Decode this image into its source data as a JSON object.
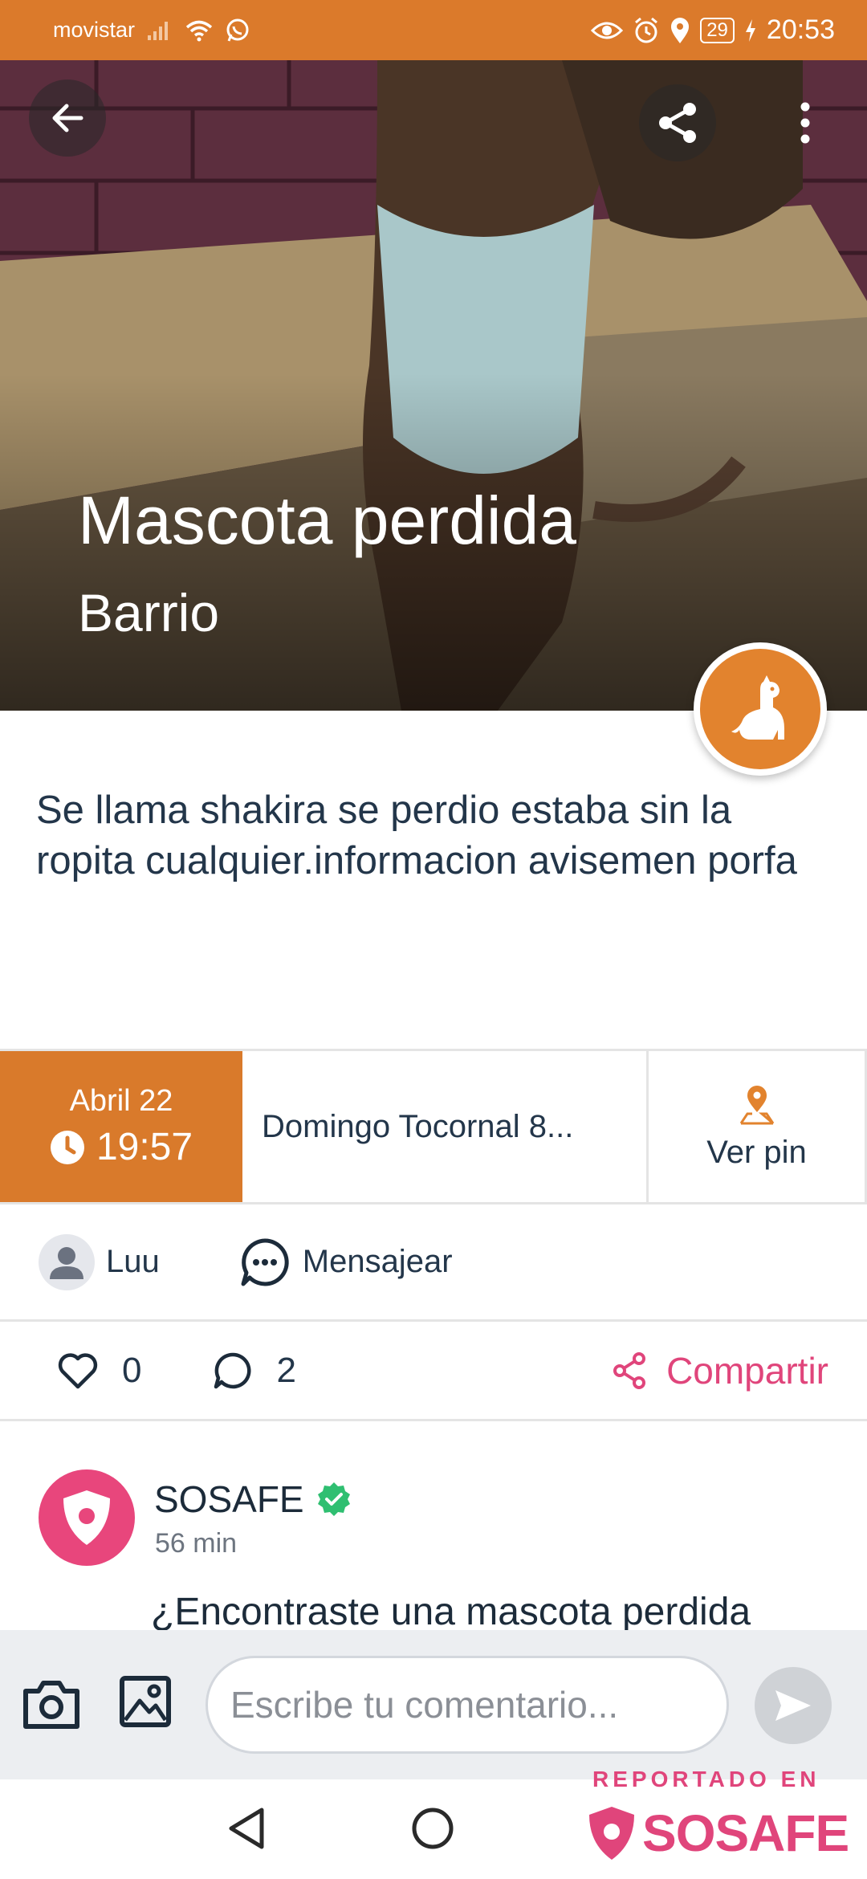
{
  "status_bar": {
    "carrier": "movistar",
    "battery": "29",
    "time": "20:53"
  },
  "hero": {
    "title": "Mascota perdida",
    "subtitle": "Barrio",
    "category_icon": "dog-icon"
  },
  "post": {
    "description": "Se llama shakira se perdio estaba sin la ropita cualquier.informacion avisemen porfa"
  },
  "info": {
    "date": "Abril 22",
    "time": "19:57",
    "address": "Domingo Tocornal  8...",
    "pin_label": "Ver pin"
  },
  "author": {
    "name": "Luu",
    "message_label": "Mensajear"
  },
  "reactions": {
    "likes": "0",
    "comments": "2",
    "share_label": "Compartir"
  },
  "comment": {
    "author": "SOSAFE",
    "time": "56 min",
    "text": "¿Encontraste una mascota perdida"
  },
  "composer": {
    "placeholder": "Escribe tu comentario..."
  },
  "watermark": {
    "top": "REPORTADO EN",
    "brand": "SOSAFE"
  },
  "colors": {
    "orange": "#db7a2b",
    "pink": "#e0457b",
    "verified": "#2fbf71"
  }
}
